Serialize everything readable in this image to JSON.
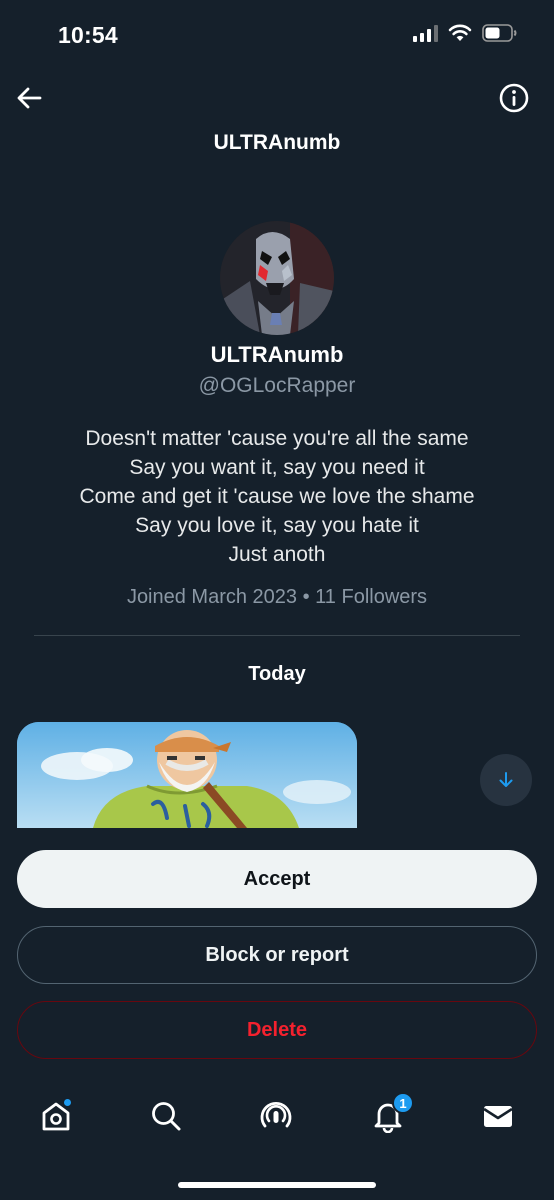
{
  "status_bar": {
    "time": "10:54"
  },
  "header": {
    "title": "ULTRAnumb"
  },
  "profile": {
    "display_name": "ULTRAnumb",
    "handle": "@OGLocRapper",
    "bio_lines": [
      "Doesn't matter 'cause you're all the same",
      "Say you want it, say you need it",
      "Come and get it 'cause we love the shame",
      "Say you love it, say you hate it",
      "Just anoth"
    ],
    "meta": "Joined March 2023 • 11 Followers"
  },
  "conversation": {
    "day_label": "Today"
  },
  "actions": {
    "accept_label": "Accept",
    "block_label": "Block or report",
    "delete_label": "Delete"
  },
  "bottom_nav": {
    "notifications_badge": "1",
    "items": [
      "home-icon",
      "search-icon",
      "spaces-icon",
      "notifications-icon",
      "messages-icon"
    ]
  },
  "colors": {
    "background": "#15202b",
    "accent": "#1d9bf0",
    "danger": "#f4212e",
    "muted_text": "#8b98a5"
  }
}
